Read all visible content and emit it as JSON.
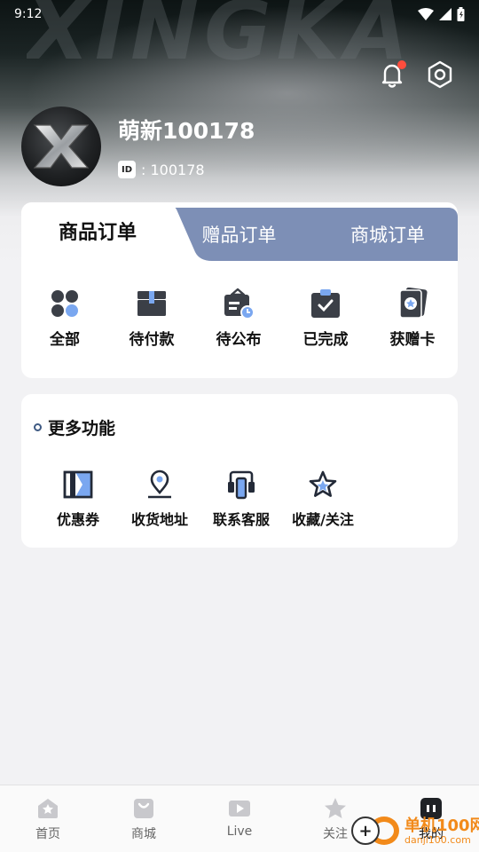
{
  "status_bar": {
    "time": "9:12"
  },
  "brand_watermark": "XINGKA",
  "header": {
    "notification_badge": true
  },
  "profile": {
    "username": "萌新100178",
    "id_badge": "ID",
    "id_value": ": 100178"
  },
  "order_tabs": [
    {
      "label": "商品订单",
      "active": true
    },
    {
      "label": "赠品订单",
      "active": false
    },
    {
      "label": "商城订单",
      "active": false
    }
  ],
  "order_items": [
    {
      "label": "全部",
      "icon": "grid-icon"
    },
    {
      "label": "待付款",
      "icon": "wallet-icon"
    },
    {
      "label": "待公布",
      "icon": "pending-announce-icon"
    },
    {
      "label": "已完成",
      "icon": "completed-check-icon"
    },
    {
      "label": "获赠卡",
      "icon": "gift-card-icon"
    }
  ],
  "more": {
    "title": "更多功能",
    "items": [
      {
        "label": "优惠券",
        "icon": "coupon-icon"
      },
      {
        "label": "收货地址",
        "icon": "location-icon"
      },
      {
        "label": "联系客服",
        "icon": "customer-service-icon"
      },
      {
        "label": "收藏/关注",
        "icon": "star-icon"
      }
    ]
  },
  "bottom_nav": [
    {
      "label": "首页",
      "icon": "home-icon",
      "active": false
    },
    {
      "label": "商城",
      "icon": "shop-bag-icon",
      "active": false
    },
    {
      "label": "Live",
      "icon": "live-play-icon",
      "active": false
    },
    {
      "label": "关注",
      "icon": "star-icon",
      "active": false
    },
    {
      "label": "我的",
      "icon": "profile-icon",
      "active": true
    }
  ],
  "site_watermark": {
    "name": "单机100网",
    "url": "danji100.com"
  },
  "colors": {
    "tab_inactive_bg": "#7d8fb6",
    "badge_red": "#ff4d3d",
    "icon_blue": "#7aa7f0",
    "icon_dark": "#3b3f47"
  }
}
